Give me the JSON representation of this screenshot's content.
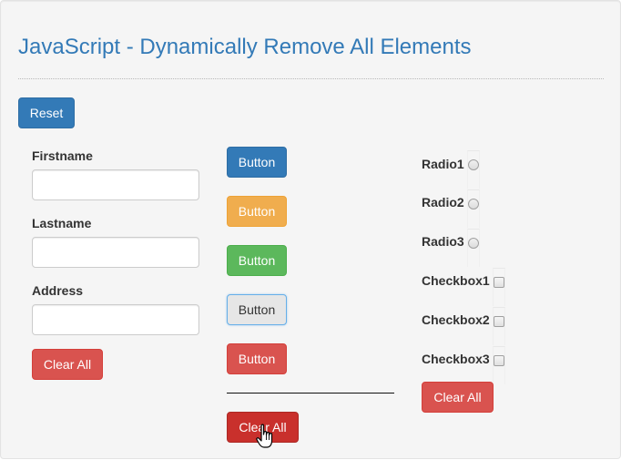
{
  "page": {
    "title": "JavaScript - Dynamically Remove All Elements",
    "reset_label": "Reset"
  },
  "form": {
    "fields": [
      {
        "label": "Firstname",
        "value": "",
        "placeholder": ""
      },
      {
        "label": "Lastname",
        "value": "",
        "placeholder": ""
      },
      {
        "label": "Address",
        "value": "",
        "placeholder": ""
      }
    ],
    "clear_label": "Clear All"
  },
  "buttons": {
    "items": [
      {
        "label": "Button",
        "style": "primary",
        "color": "#337ab7"
      },
      {
        "label": "Button",
        "style": "warning",
        "color": "#f0ad4e"
      },
      {
        "label": "Button",
        "style": "success",
        "color": "#5cb85c"
      },
      {
        "label": "Button",
        "style": "default",
        "color": "#e6e6e6"
      },
      {
        "label": "Button",
        "style": "danger",
        "color": "#d9534f"
      }
    ],
    "clear_label": "Clear All"
  },
  "options": {
    "radios": [
      {
        "label": "Radio1",
        "checked": false
      },
      {
        "label": "Radio2",
        "checked": false
      },
      {
        "label": "Radio3",
        "checked": false
      }
    ],
    "checkboxes": [
      {
        "label": "Checkbox1",
        "checked": false
      },
      {
        "label": "Checkbox2",
        "checked": false
      },
      {
        "label": "Checkbox3",
        "checked": false
      }
    ],
    "clear_label": "Clear All"
  },
  "cursor": {
    "type": "hand-pointer-icon"
  }
}
